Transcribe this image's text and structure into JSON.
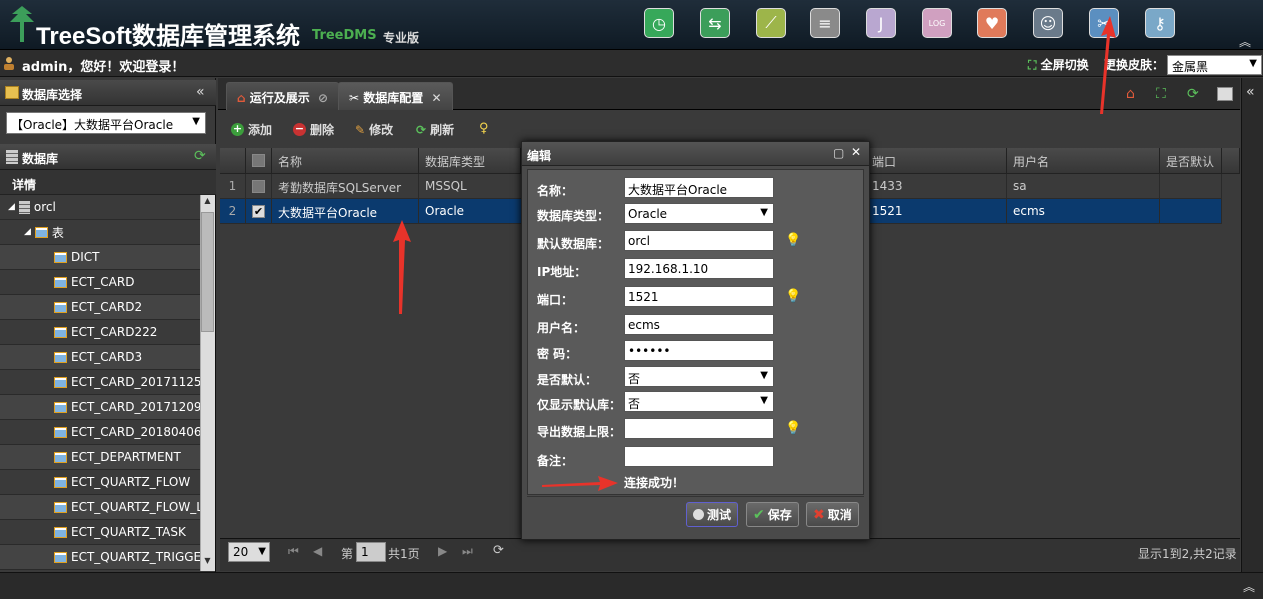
{
  "header": {
    "title": "TreeSoft数据库管理系统",
    "subtitle": "TreeDMS",
    "edition": "专业版",
    "icons": [
      {
        "name": "clock-icon",
        "glyph": "◷",
        "color": "#37a85a"
      },
      {
        "name": "swap-icon",
        "glyph": "⇆",
        "color": "#3c9e5a"
      },
      {
        "name": "chart-icon",
        "glyph": "⟋",
        "color": "#9db54a"
      },
      {
        "name": "database-icon",
        "glyph": "≡",
        "color": "#8a8a8a"
      },
      {
        "name": "java-icon",
        "glyph": "J",
        "color": "#b9a7d0"
      },
      {
        "name": "log-icon",
        "glyph": "LOG",
        "color": "#d0a0c0"
      },
      {
        "name": "heart-icon",
        "glyph": "♥",
        "color": "#e07a5a"
      },
      {
        "name": "user-icon",
        "glyph": "☺",
        "color": "#6a7a8a"
      },
      {
        "name": "tools-icon",
        "glyph": "✂",
        "color": "#5b8fc0"
      },
      {
        "name": "key-icon",
        "glyph": "⚷",
        "color": "#7aa8c8"
      }
    ]
  },
  "userbar": {
    "welcome": "admin，您好！欢迎登录！",
    "fullscreen": "全屏切换",
    "skin_label": "更换皮肤：",
    "skin_value": "金属黑"
  },
  "left": {
    "db_select_title": "数据库选择",
    "db_select_value": "【Oracle】大数据平台Oracle",
    "db_title": "数据库",
    "detail_label": "详情",
    "root": "orcl",
    "table_node": "表",
    "tables": [
      "DICT",
      "ECT_CARD",
      "ECT_CARD2",
      "ECT_CARD222",
      "ECT_CARD3",
      "ECT_CARD_20171125",
      "ECT_CARD_20171209",
      "ECT_CARD_20180406",
      "ECT_DEPARTMENT",
      "ECT_QUARTZ_FLOW",
      "ECT_QUARTZ_FLOW_L",
      "ECT_QUARTZ_TASK",
      "ECT_QUARTZ_TRIGGE"
    ]
  },
  "tabs": [
    {
      "label": "运行及展示"
    },
    {
      "label": "数据库配置"
    }
  ],
  "toolbar": {
    "add": "添加",
    "delete": "删除",
    "edit": "修改",
    "refresh": "刷新"
  },
  "grid": {
    "headers": [
      "名称",
      "数据库类型",
      "端口",
      "用户名",
      "是否默认"
    ],
    "rows": [
      {
        "num": "1",
        "name": "考勤数据库SQLServer",
        "type": "MSSQL",
        "port": "1433",
        "user": "sa",
        "default": "",
        "checked": false
      },
      {
        "num": "2",
        "name": "大数据平台Oracle",
        "type": "Oracle",
        "port": "1521",
        "user": "ecms",
        "default": "",
        "checked": true
      }
    ]
  },
  "pager": {
    "page_size": "20",
    "page_prefix": "第",
    "page_value": "1",
    "page_suffix": "共1页",
    "summary": "显示1到2,共2记录"
  },
  "dialog": {
    "title": "编辑",
    "fields": {
      "name_label": "名称：",
      "name_value": "大数据平台Oracle",
      "type_label": "数据库类型：",
      "type_value": "Oracle",
      "defaultdb_label": "默认数据库：",
      "defaultdb_value": "orcl",
      "ip_label": "IP地址：",
      "ip_value": "192.168.1.10",
      "port_label": "端口：",
      "port_value": "1521",
      "user_label": "用户名：",
      "user_value": "ecms",
      "password_label": "密 码：",
      "password_value": "••••••",
      "isdefault_label": "是否默认：",
      "isdefault_value": "否",
      "onlydefault_label": "仅显示默认库：",
      "onlydefault_value": "否",
      "exportlimit_label": "导出数据上限：",
      "exportlimit_value": "",
      "remark_label": "备注：",
      "remark_value": ""
    },
    "status": "连接成功！",
    "buttons": {
      "test": "测试",
      "save": "保存",
      "cancel": "取消"
    }
  },
  "colors": {
    "accent": "#0b3a6e",
    "annotation_arrow": "#e8332a",
    "hint": "#f3d44e"
  }
}
